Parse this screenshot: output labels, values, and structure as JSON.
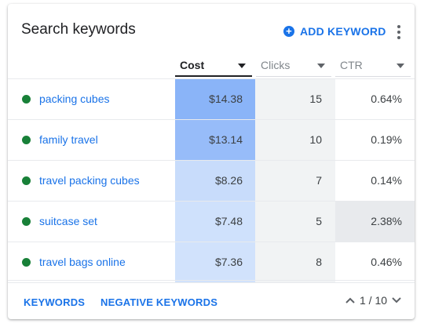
{
  "header": {
    "title": "Search keywords",
    "add_label": "ADD KEYWORD",
    "add_icon": "add-circle-icon",
    "more_icon": "more-vert-icon"
  },
  "columns": {
    "cost": "Cost",
    "clicks": "Clicks",
    "ctr": "CTR"
  },
  "rows": [
    {
      "keyword": "packing cubes",
      "cost": "$14.38",
      "clicks": "15",
      "ctr": "0.64%",
      "cost_intensity": 1.0
    },
    {
      "keyword": "family travel",
      "cost": "$13.14",
      "clicks": "10",
      "ctr": "0.19%",
      "cost_intensity": 0.91
    },
    {
      "keyword": "travel packing cubes",
      "cost": "$8.26",
      "clicks": "7",
      "ctr": "0.14%",
      "cost_intensity": 0.57
    },
    {
      "keyword": "suitcase set",
      "cost": "$7.48",
      "clicks": "5",
      "ctr": "2.38%",
      "cost_intensity": 0.52
    },
    {
      "keyword": "travel bags online",
      "cost": "$7.36",
      "clicks": "8",
      "ctr": "0.46%",
      "cost_intensity": 0.51
    }
  ],
  "status_color": "#188038",
  "highlight_color": "#aecbfa",
  "footer": {
    "keywords_label": "KEYWORDS",
    "negative_label": "NEGATIVE KEYWORDS",
    "page_text": "1 / 10"
  }
}
